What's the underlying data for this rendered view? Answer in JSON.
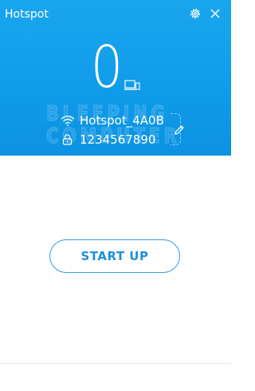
{
  "window": {
    "title": "Hotspot"
  },
  "header": {
    "connected_count": "0",
    "ssid": "Hotspot_4A0B",
    "password": "1234567890",
    "watermark_line1": "BLEEPING",
    "watermark_line2": "COMPUTER"
  },
  "actions": {
    "start_label": "START UP"
  },
  "icons": {
    "settings": "gear-icon",
    "close": "close-icon",
    "devices": "devices-icon",
    "wifi": "wifi-icon",
    "lock": "lock-icon",
    "edit": "pencil-icon"
  },
  "colors": {
    "header_blue": "#1aa6ee",
    "accent": "#1d8fdc",
    "button_border": "#2f9be4",
    "text_on_blue": "#ffffff"
  }
}
